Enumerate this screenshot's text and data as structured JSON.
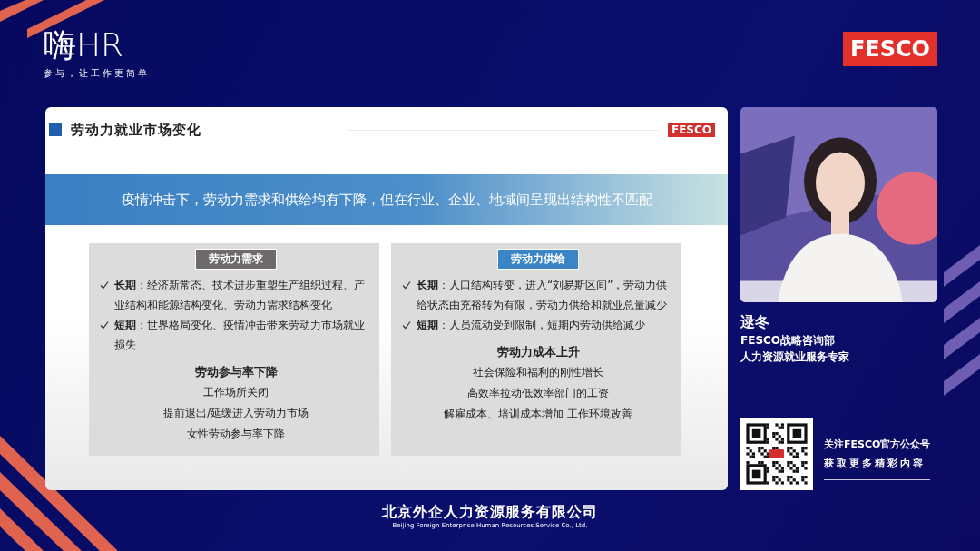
{
  "header": {
    "logo": "嗨HR",
    "tagline": "参与，让工作更简单",
    "brand_badge": "FESCO"
  },
  "slide": {
    "title": "劳动力就业市场变化",
    "badge": "FESCO",
    "banner": "疫情冲击下，劳动力需求和供给均有下降，但在行业、企业、地域间呈现出结构性不匹配",
    "panels": [
      {
        "heading": "劳动力需求",
        "color": "#6e6a6b",
        "bullets": [
          "**长期**：经济新常态、技术进步重塑生产组织过程、产业结构和能源结构变化、劳动力需求结构变化",
          "**短期**：世界格局变化、疫情冲击带来劳动力市场就业损失"
        ],
        "subheading": "劳动参与率下降",
        "lines": [
          "工作场所关闭",
          "提前退出/延缓进入劳动力市场",
          "女性劳动参与率下降"
        ]
      },
      {
        "heading": "劳动力供给",
        "color": "#3a85c6",
        "bullets": [
          "**长期**：人口结构转变，进入“刘易斯区间”，劳动力供给状态由充裕转为有限，劳动力供给和就业总量减少",
          "**短期**：人员流动受到限制，短期内劳动供给减少"
        ],
        "subheading": "劳动力成本上升",
        "lines": [
          "社会保险和福利的刚性增长",
          "高效率拉动低效率部门的工资",
          "解雇成本、培训成本增加  工作环境改善"
        ]
      }
    ]
  },
  "speaker": {
    "video": {
      "kind": "picture"
    },
    "name": "逯冬",
    "titles": [
      "FESCO战略咨询部",
      "人力资源就业服务专家"
    ]
  },
  "follow": {
    "lines": [
      "关注FESCO官方公众号",
      "获取更多精彩内容"
    ]
  },
  "footer": {
    "company": "北京外企人力资源服务有限公司",
    "company_en": "Beijing Foreign Enterprise Human Resources Service Co., Ltd."
  }
}
